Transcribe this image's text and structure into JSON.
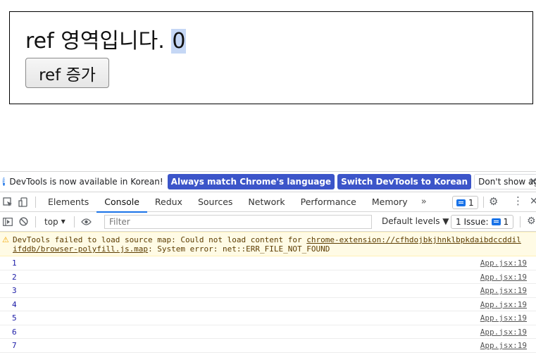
{
  "app": {
    "ref_label": "ref 영역입니다. ",
    "ref_value": "0",
    "button_label": "ref 증가"
  },
  "infobar": {
    "message": "DevTools is now available in Korean!",
    "match_language": "Always match Chrome's language",
    "switch_korean": "Switch DevTools to Korean",
    "dont_show": "Don't show again",
    "close": "✕"
  },
  "tabs": [
    "Elements",
    "Console",
    "Redux",
    "Sources",
    "Network",
    "Performance",
    "Memory"
  ],
  "more_tabs": "»",
  "message_count": "1",
  "console_bar": {
    "context": "top",
    "filter_placeholder": "Filter",
    "levels": "Default levels ▼",
    "issues_label": "1 Issue:",
    "issues_count": "1"
  },
  "warning": {
    "line1_prefix": "DevTools failed to load source map: Could not load content for ",
    "line1_link": "chrome-extension://cfhdojbkjhnklbpkdaibdccddil",
    "line2_link": "ifddb/browser-polyfill.js.map",
    "line2_suffix": ": System error: net::ERR_FILE_NOT_FOUND"
  },
  "logs": [
    {
      "value": "1",
      "source": "App.jsx:19"
    },
    {
      "value": "2",
      "source": "App.jsx:19"
    },
    {
      "value": "3",
      "source": "App.jsx:19"
    },
    {
      "value": "4",
      "source": "App.jsx:19"
    },
    {
      "value": "5",
      "source": "App.jsx:19"
    },
    {
      "value": "6",
      "source": "App.jsx:19"
    },
    {
      "value": "7",
      "source": "App.jsx:19"
    }
  ]
}
